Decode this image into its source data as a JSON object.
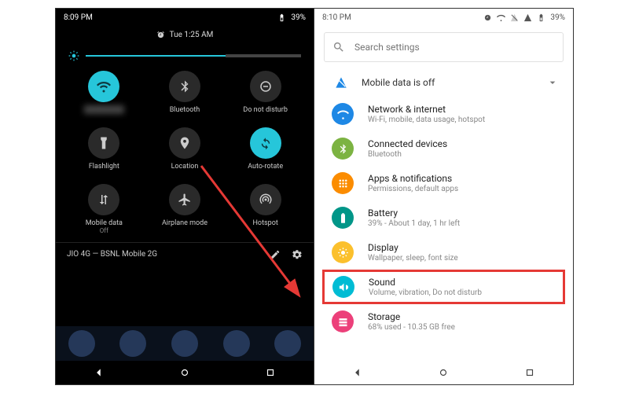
{
  "left": {
    "status": {
      "time": "8:09 PM",
      "battery": "39%"
    },
    "qs": {
      "alarm_time": "Tue 1:25 AM",
      "tiles": {
        "wifi": "",
        "bluetooth": "Bluetooth",
        "dnd": "Do not disturb",
        "flashlight": "Flashlight",
        "location": "Location",
        "autorotate": "Auto-rotate",
        "mobiledata": "Mobile data",
        "mobiledata_sub": "Off",
        "airplane": "Airplane mode",
        "hotspot": "Hotspot"
      },
      "carrier": "JIO 4G — BSNL Mobile 2G"
    }
  },
  "right": {
    "status": {
      "time": "8:10 PM",
      "battery": "39%"
    },
    "search_placeholder": "Search settings",
    "mobile_data_off": "Mobile data is off",
    "items": {
      "network": {
        "title": "Network & internet",
        "sub": "Wi-Fi, mobile, data usage, hotspot",
        "color": "#1e88e5"
      },
      "connected": {
        "title": "Connected devices",
        "sub": "Bluetooth",
        "color": "#7cb342"
      },
      "apps": {
        "title": "Apps & notifications",
        "sub": "Permissions, default apps",
        "color": "#fb8c00"
      },
      "battery": {
        "title": "Battery",
        "sub": "39% - About 1 day, 1 hr left",
        "color": "#009688"
      },
      "display": {
        "title": "Display",
        "sub": "Wallpaper, sleep, font size",
        "color": "#fbc02d"
      },
      "sound": {
        "title": "Sound",
        "sub": "Volume, vibration, Do not disturb",
        "color": "#00bcd4"
      },
      "storage": {
        "title": "Storage",
        "sub": "68% used - 10.35 GB free",
        "color": "#ec407a"
      }
    }
  }
}
